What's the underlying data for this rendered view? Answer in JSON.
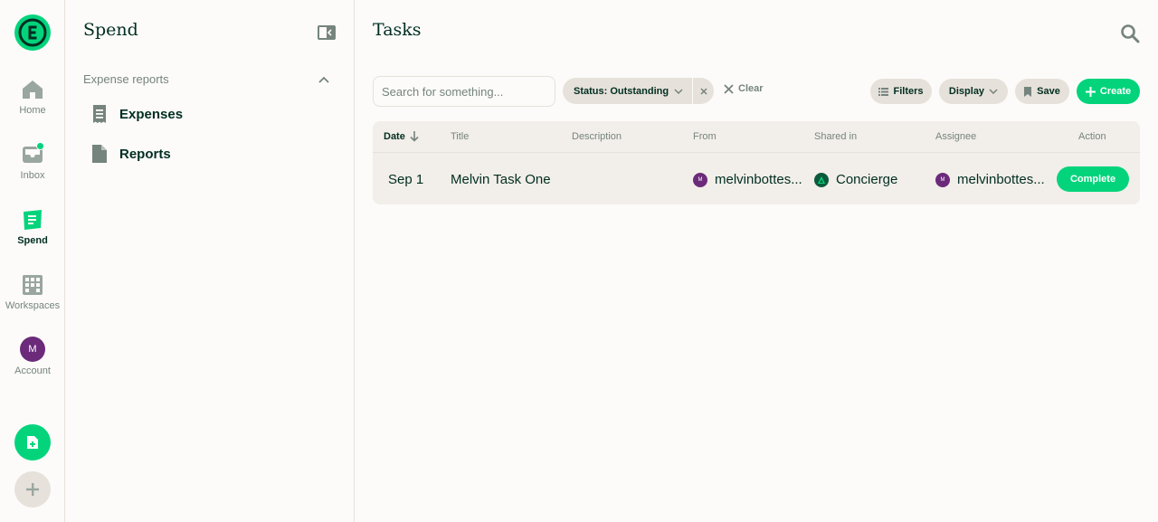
{
  "nav": {
    "items": [
      {
        "label": "Home",
        "icon": "home-icon"
      },
      {
        "label": "Inbox",
        "icon": "inbox-icon"
      },
      {
        "label": "Spend",
        "icon": "receipt-icon"
      },
      {
        "label": "Workspaces",
        "icon": "building-icon"
      },
      {
        "label": "Account",
        "icon": "avatar"
      }
    ],
    "account_initial": "M",
    "active": "Spend"
  },
  "sidebar": {
    "title": "Spend",
    "section_label": "Expense reports",
    "links": [
      {
        "label": "Expenses",
        "icon": "receipt-icon"
      },
      {
        "label": "Reports",
        "icon": "document-icon"
      }
    ]
  },
  "main": {
    "title": "Tasks",
    "search_placeholder": "Search for something...",
    "status_filter": "Status: Outstanding",
    "clear_label": "Clear",
    "filters_label": "Filters",
    "display_label": "Display",
    "save_label": "Save",
    "create_label": "Create"
  },
  "table": {
    "columns": [
      "Date",
      "Title",
      "Description",
      "From",
      "Shared in",
      "Assignee",
      "Action"
    ],
    "rows": [
      {
        "date": "Sep 1",
        "title": "Melvin Task One",
        "description": "",
        "from": "melvinbottes...",
        "from_initial": "M",
        "shared_in": "Concierge",
        "assignee": "melvinbottes...",
        "assignee_initial": "M",
        "action": "Complete"
      }
    ]
  },
  "colors": {
    "accent": "#03d47c",
    "text": "#002e22",
    "muted": "#76847e",
    "avatar": "#6b2b7a"
  }
}
